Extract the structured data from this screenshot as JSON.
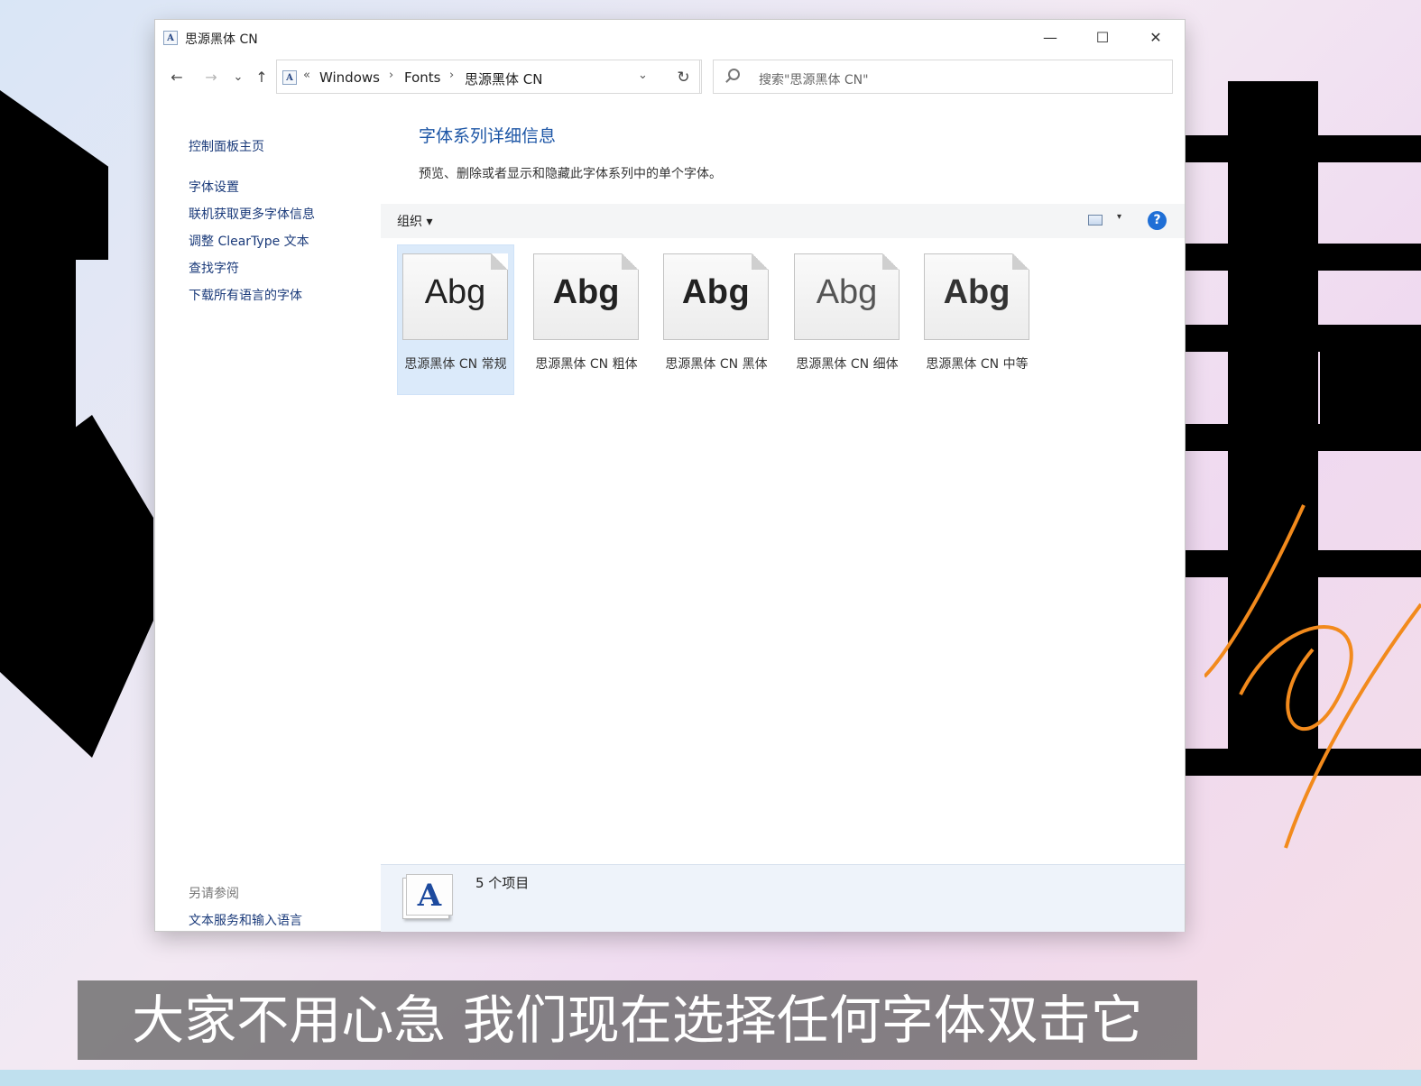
{
  "window": {
    "title": "思源黑体 CN",
    "minimize_glyph": "—",
    "maximize_glyph": "☐",
    "close_glyph": "✕"
  },
  "nav": {
    "back": "←",
    "forward": "→",
    "recent": "⌄",
    "up": "↑",
    "address_prefix": "«",
    "breadcrumb": [
      "Windows",
      "Fonts",
      "思源黑体 CN"
    ],
    "breadcrumb_sep": "›",
    "dropdown": "⌄",
    "refresh": "↻",
    "search_placeholder": "搜索\"思源黑体 CN\""
  },
  "sidebar": {
    "links": [
      "控制面板主页",
      "字体设置",
      "联机获取更多字体信息",
      "调整 ClearType 文本",
      "查找字符",
      "下载所有语言的字体"
    ],
    "see_also_heading": "另请参阅",
    "see_also_links": [
      "文本服务和输入语言"
    ]
  },
  "main": {
    "title": "字体系列详细信息",
    "description": "预览、删除或者显示和隐藏此字体系列中的单个字体。",
    "organize_label": "组织 ▾",
    "view_caret": "▾",
    "help": "?"
  },
  "fonts": [
    {
      "sample": "Abg",
      "label": "思源黑体 CN 常规",
      "weight": "regular",
      "selected": true
    },
    {
      "sample": "Abg",
      "label": "思源黑体 CN 粗体",
      "weight": "bold",
      "selected": false
    },
    {
      "sample": "Abg",
      "label": "思源黑体 CN 黑体",
      "weight": "heavy",
      "selected": false
    },
    {
      "sample": "Abg",
      "label": "思源黑体 CN 细体",
      "weight": "light",
      "selected": false
    },
    {
      "sample": "Abg",
      "label": "思源黑体 CN 中等",
      "weight": "medium",
      "selected": false
    }
  ],
  "status": {
    "count_text": "5 个项目",
    "icon_letter": "A"
  },
  "subtitle": "大家不用心急 我们现在选择任何字体双击它",
  "colors": {
    "link": "#1a3a7a",
    "heading": "#1d56a6",
    "selection": "#dbeafa",
    "subtitle_bg": "#5f5f5f",
    "accent_orange": "#f28a1c"
  }
}
